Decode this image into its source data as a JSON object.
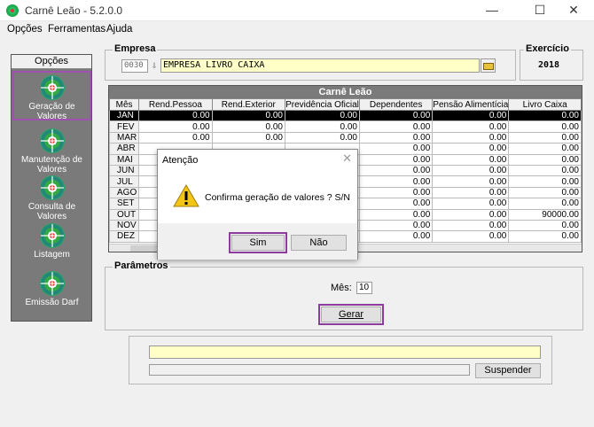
{
  "window": {
    "title": "Carnê Leão - 5.2.0.0",
    "minimize": "—",
    "maximize": "☐",
    "close": "✕"
  },
  "menu": [
    "Opções",
    "Ferramentas",
    "Ajuda"
  ],
  "sidebar": {
    "title": "Opções",
    "items": [
      {
        "label": "Geração de Valores",
        "icon": "globe-icon"
      },
      {
        "label": "Manutenção de Valores",
        "icon": "globe-icon"
      },
      {
        "label": "Consulta de Valores",
        "icon": "globe-icon"
      },
      {
        "label": "Listagem",
        "icon": "globe-icon"
      },
      {
        "label": "Emissão Darf",
        "icon": "globe-icon"
      }
    ]
  },
  "empresa": {
    "label": "Empresa",
    "code": "0030",
    "name": "EMPRESA LIVRO CAIXA"
  },
  "exercicio": {
    "label": "Exercício",
    "value": "2018"
  },
  "table": {
    "title": "Carnê Leão",
    "columns": [
      "Mês",
      "Rend.Pessoa",
      "Rend.Exterior",
      "Previdência Oficial",
      "Dependentes",
      "Pensão Alimentícia",
      "Livro Caixa"
    ],
    "rows": [
      [
        "JAN",
        "0.00",
        "0.00",
        "0.00",
        "0.00",
        "0.00",
        "0.00"
      ],
      [
        "FEV",
        "0.00",
        "0.00",
        "0.00",
        "0.00",
        "0.00",
        "0.00"
      ],
      [
        "MAR",
        "0.00",
        "0.00",
        "0.00",
        "0.00",
        "0.00",
        "0.00"
      ],
      [
        "ABR",
        "",
        "",
        "",
        "0.00",
        "0.00",
        "0.00"
      ],
      [
        "MAI",
        "",
        "",
        "",
        "0.00",
        "0.00",
        "0.00"
      ],
      [
        "JUN",
        "",
        "",
        "",
        "0.00",
        "0.00",
        "0.00"
      ],
      [
        "JUL",
        "",
        "",
        "",
        "0.00",
        "0.00",
        "0.00"
      ],
      [
        "AGO",
        "",
        "",
        "",
        "0.00",
        "0.00",
        "0.00"
      ],
      [
        "SET",
        "",
        "",
        "",
        "0.00",
        "0.00",
        "0.00"
      ],
      [
        "OUT",
        "",
        "",
        "",
        "0.00",
        "0.00",
        "90000.00"
      ],
      [
        "NOV",
        "",
        "",
        "",
        "0.00",
        "0.00",
        "0.00"
      ],
      [
        "DEZ",
        "",
        "",
        "",
        "0.00",
        "0.00",
        "0.00"
      ]
    ],
    "selected_row": "JAN"
  },
  "parametros": {
    "label": "Parâmetros",
    "mes_label": "Mês:",
    "mes_value": "10",
    "gerar_label": "Gerar"
  },
  "suspender_label": "Suspender",
  "dialog": {
    "title": "Atenção",
    "close": "✕",
    "message": "Confirma geração de valores ? S/N",
    "yes_label": "Sim",
    "no_label": "Não"
  },
  "colors": {
    "highlight": "#8a3d9a",
    "field_yellow": "#ffffc8",
    "sidebar_gray": "#7a7a7a"
  }
}
